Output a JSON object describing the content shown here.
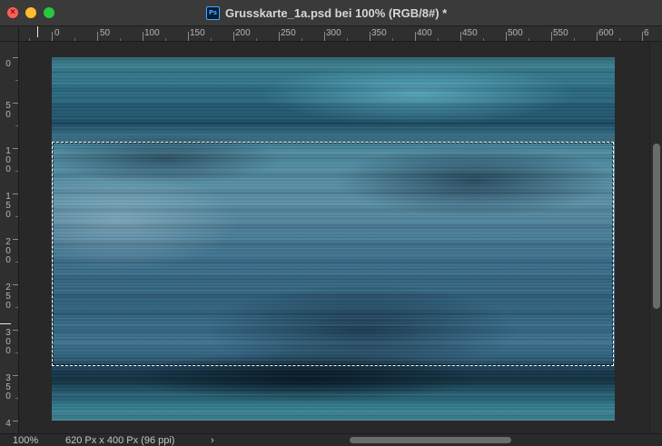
{
  "window": {
    "title": "Grusskarte_1a.psd bei 100% (RGB/8#) *",
    "app_icon": "ps-icon",
    "app_icon_text": "Ps",
    "close_glyph": "×"
  },
  "ruler_h": {
    "labels": [
      "0",
      "50",
      "100",
      "150",
      "200",
      "250",
      "300",
      "350",
      "400",
      "450",
      "500",
      "550",
      "600",
      "6"
    ]
  },
  "ruler_v": {
    "labels": [
      "0",
      "5\n0",
      "1\n0\n0",
      "1\n5\n0",
      "2\n0\n0",
      "2\n5\n0",
      "3\n0\n0",
      "3\n5\n0",
      "4"
    ]
  },
  "status": {
    "zoom": "100%",
    "doc_info": "620 Px x 400 Px (96 ppi)",
    "arrow": "›"
  },
  "colors": {
    "selection_border": "#ffffff",
    "traffic_close": "#fe5f57",
    "traffic_min": "#febc2e",
    "traffic_max": "#28c840"
  }
}
